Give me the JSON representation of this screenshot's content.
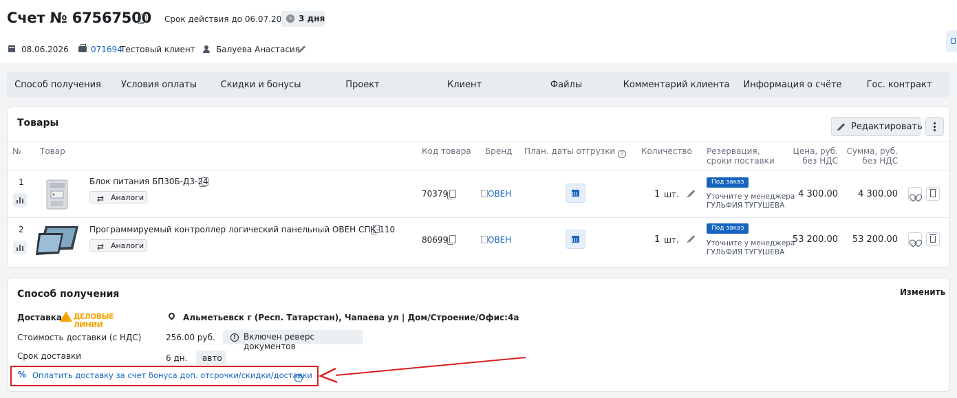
{
  "header": {
    "title": "Счет № 67567500",
    "validity": "Срок действия до 06.07.2026",
    "days_left": "3 дня",
    "date": "08.06.2026",
    "client_code": "071694",
    "client_name": "Тестовый клиент",
    "manager": "Балуева Анастасия"
  },
  "tabs": [
    "Способ получения",
    "Условия оплаты",
    "Скидки и бонусы",
    "Проект",
    "Клиент",
    "Файлы",
    "Комментарий клиента",
    "Информация о счёте",
    "Гос. контракт"
  ],
  "products": {
    "title": "Товары",
    "edit_label": "Редактировать",
    "columns": {
      "n": "№",
      "product": "Товар",
      "code": "Код товара",
      "brand": "Бренд",
      "ship": "План. даты отгрузки",
      "qty": "Количество",
      "reserve_1": "Резервация,",
      "reserve_2": "сроки поставки",
      "price_1": "Цена, руб.",
      "price_2": "без НДС",
      "sum_1": "Сумма, руб.",
      "sum_2": "без НДС"
    },
    "analog_label": "Аналоги",
    "rows": [
      {
        "n": "1",
        "name": "Блок питания БП30Б-Д3-24",
        "code": "70379",
        "brand": "ОВЕН",
        "qty": "1",
        "unit": "шт.",
        "tag": "Под заказ",
        "note_1": "Уточните у менеджера",
        "note_2": "ГУЛЬФИЯ ТУГУШЕВА",
        "price": "4 300.00",
        "sum": "4 300.00"
      },
      {
        "n": "2",
        "name": "Программируемый контроллер логический панельный ОВЕН СПК-110",
        "code": "80699",
        "brand": "ОВЕН",
        "qty": "1",
        "unit": "шт.",
        "tag": "Под заказ",
        "note_1": "Уточните у менеджера",
        "note_2": "ГУЛЬФИЯ ТУГУШЕВА",
        "price": "53 200.00",
        "sum": "53 200.00"
      }
    ]
  },
  "delivery": {
    "title": "Способ получения",
    "change_label": "Изменить",
    "method_label": "Доставка",
    "carrier": "ДЕЛОВЫЕ ЛИНИИ",
    "address": "Альметьевск г (Респ. Татарстан), Чапаева ул | Дом/Строение/Офис:4а",
    "cost_label": "Стоимость доставки (с НДС)",
    "cost_value": "256.00 руб.",
    "reverse_docs": "Включен реверс документов",
    "term_label": "Срок доставки",
    "term_value": "6 дн.",
    "term_mode": "авто",
    "pay_bonus": "Оплатить доставку за счет бонуса доп. отсрочки/скидки/доставки"
  },
  "colors": {
    "accent": "#1565c0",
    "highlight": "#d9201f",
    "carrier_brand": "#f5a300"
  }
}
